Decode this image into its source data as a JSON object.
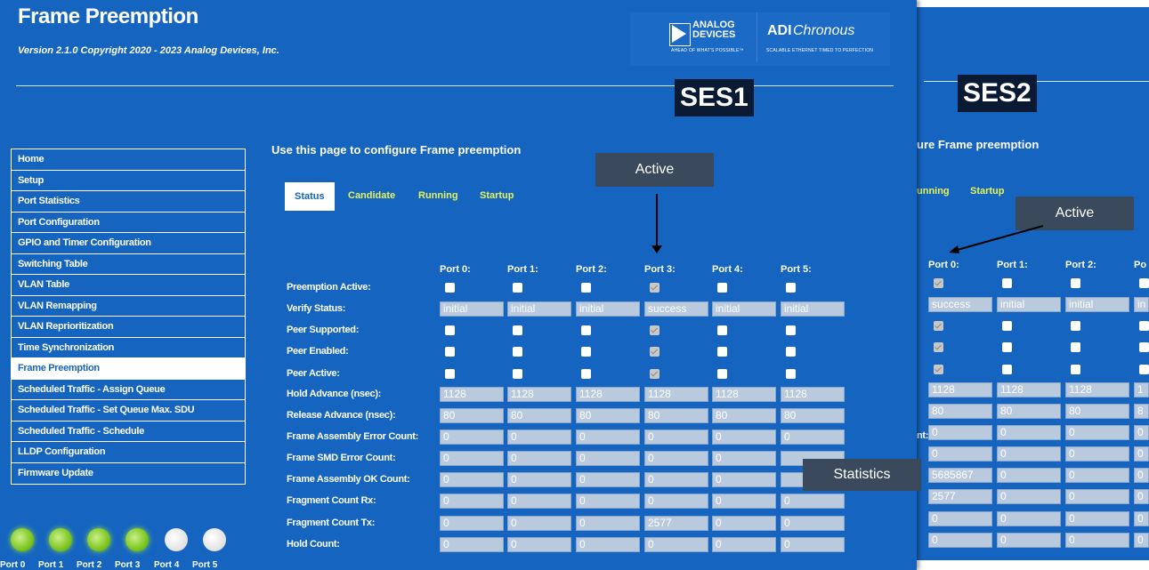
{
  "app": {
    "title": "Frame Preemption",
    "version": "Version 2.1.0 Copyright 2020 - 2023 Analog Devices, Inc."
  },
  "logos": {
    "adi_line1": "ANALOG",
    "adi_line2": "DEVICES",
    "adi_tagline": "AHEAD OF WHAT'S POSSIBLE™",
    "chronous_brand": "ADI",
    "chronous_name": "Chronous",
    "chronous_tagline": "SCALABLE ETHERNET TIMED TO PERFECTION"
  },
  "labels": {
    "ses1": "SES1",
    "ses2": "SES2",
    "active_callout_1": "Active",
    "active_callout_2": "Active",
    "statistics_callout": "Statistics"
  },
  "sidebar": {
    "items": [
      {
        "label": "Home"
      },
      {
        "label": "Setup"
      },
      {
        "label": "Port Statistics"
      },
      {
        "label": "Port Configuration"
      },
      {
        "label": "GPIO and Timer Configuration"
      },
      {
        "label": "Switching Table"
      },
      {
        "label": "VLAN Table"
      },
      {
        "label": "VLAN Remapping"
      },
      {
        "label": "VLAN Reprioritization"
      },
      {
        "label": "Time Synchronization"
      },
      {
        "label": "Frame Preemption",
        "active": true
      },
      {
        "label": "Scheduled Traffic - Assign Queue"
      },
      {
        "label": "Scheduled Traffic - Set Queue Max. SDU"
      },
      {
        "label": "Scheduled Traffic - Schedule"
      },
      {
        "label": "LLDP Configuration"
      },
      {
        "label": "Firmware Update"
      }
    ]
  },
  "leds": [
    {
      "label": "Port 0",
      "state": "on"
    },
    {
      "label": "Port 1",
      "state": "on"
    },
    {
      "label": "Port 2",
      "state": "on"
    },
    {
      "label": "Port 3",
      "state": "on"
    },
    {
      "label": "Port 4",
      "state": "off"
    },
    {
      "label": "Port 5",
      "state": "off"
    }
  ],
  "colors": {
    "panel": "#1565c0",
    "tab_accent": "#e6f35a",
    "led_on": "#7ec620"
  },
  "main": {
    "heading": "Use this page to configure Frame preemption",
    "tabs": [
      "Status",
      "Candidate",
      "Running",
      "Startup"
    ],
    "active_tab": "Status",
    "ports": [
      "Port 0:",
      "Port 1:",
      "Port 2:",
      "Port 3:",
      "Port 4:",
      "Port 5:"
    ],
    "rows": {
      "preemption_active": {
        "label": "Preemption Active:",
        "values": [
          false,
          false,
          false,
          true,
          false,
          false
        ]
      },
      "verify_status": {
        "label": "Verify Status:",
        "values": [
          "initial",
          "initial",
          "initial",
          "success",
          "initial",
          "initial"
        ]
      },
      "peer_supported": {
        "label": "Peer Supported:",
        "values": [
          false,
          false,
          false,
          true,
          false,
          false
        ]
      },
      "peer_enabled": {
        "label": "Peer Enabled:",
        "values": [
          false,
          false,
          false,
          true,
          false,
          false
        ]
      },
      "peer_active": {
        "label": "Peer Active:",
        "values": [
          false,
          false,
          false,
          true,
          false,
          false
        ]
      },
      "hold_advance": {
        "label": "Hold Advance (nsec):",
        "values": [
          "1128",
          "1128",
          "1128",
          "1128",
          "1128",
          "1128"
        ]
      },
      "release_advance": {
        "label": "Release Advance (nsec):",
        "values": [
          "80",
          "80",
          "80",
          "80",
          "80",
          "80"
        ]
      },
      "frame_assembly_error": {
        "label": "Frame Assembly Error Count:",
        "values": [
          "0",
          "0",
          "0",
          "0",
          "0",
          "0"
        ]
      },
      "frame_smd_error": {
        "label": "Frame SMD Error Count:",
        "values": [
          "0",
          "0",
          "0",
          "0",
          "0",
          ""
        ]
      },
      "frame_assembly_ok": {
        "label": "Frame Assembly OK Count:",
        "values": [
          "0",
          "0",
          "0",
          "0",
          "0",
          ""
        ]
      },
      "fragment_rx": {
        "label": "Fragment Count Rx:",
        "values": [
          "0",
          "0",
          "0",
          "0",
          "0",
          "0"
        ]
      },
      "fragment_tx": {
        "label": "Fragment Count Tx:",
        "values": [
          "0",
          "0",
          "0",
          "2577",
          "0",
          "0"
        ]
      },
      "hold_count": {
        "label": "Hold Count:",
        "values": [
          "0",
          "0",
          "0",
          "0",
          "0",
          "0"
        ]
      }
    }
  },
  "ses2": {
    "heading_fragment": "ure Frame preemption",
    "tabs": [
      "unning",
      "Startup"
    ],
    "ports": [
      "Port 0:",
      "Port 1:",
      "Port 2:",
      "Po"
    ],
    "label_fragment": "nt:",
    "rows": {
      "preemption_active": [
        true,
        false,
        false,
        false
      ],
      "verify_status": [
        "success",
        "initial",
        "initial",
        "in"
      ],
      "peer_supported": [
        true,
        false,
        false,
        false
      ],
      "peer_enabled": [
        true,
        false,
        false,
        false
      ],
      "peer_active": [
        true,
        false,
        false,
        false
      ],
      "hold_advance": [
        "1128",
        "1128",
        "1128",
        "1"
      ],
      "release_advance": [
        "80",
        "80",
        "80",
        "8"
      ],
      "frame_assembly_error": [
        "0",
        "0",
        "0",
        "0"
      ],
      "frame_smd_error": [
        "0",
        "0",
        "0",
        "0"
      ],
      "frame_assembly_ok": [
        "5685867",
        "0",
        "0",
        "0"
      ],
      "fragment_rx": [
        "2577",
        "0",
        "0",
        "0"
      ],
      "fragment_tx": [
        "0",
        "0",
        "0",
        "0"
      ],
      "hold_count": [
        "0",
        "0",
        "0",
        "0"
      ]
    }
  }
}
